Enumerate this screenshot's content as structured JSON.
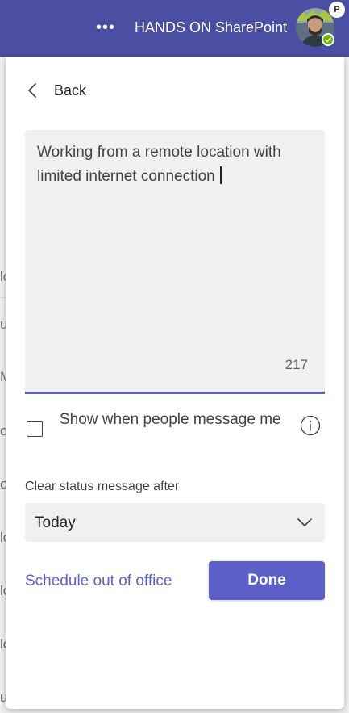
{
  "header": {
    "more_icon": "more-horizontal-icon",
    "more_glyph": "•••",
    "org_name": "HANDS ON SharePoint",
    "avatar_badge": "P",
    "presence_status": "available",
    "colors": {
      "bar": "#4b4fa4",
      "presence": "#6bb700"
    }
  },
  "background_fragments": [
    "lo",
    "u",
    "M",
    "o",
    "o",
    "lo",
    "lo",
    "lo",
    "u"
  ],
  "panel": {
    "back_label": "Back",
    "message": {
      "text": "Working from a remote location with limited internet connection",
      "chars_remaining": "217"
    },
    "show_when_message_label": "Show when people message me",
    "show_when_message_checked": false,
    "clear_after_label": "Clear status message after",
    "clear_after_value": "Today",
    "schedule_ooo_label": "Schedule out of office",
    "done_label": "Done",
    "accent_color": "#5b5fc7"
  }
}
